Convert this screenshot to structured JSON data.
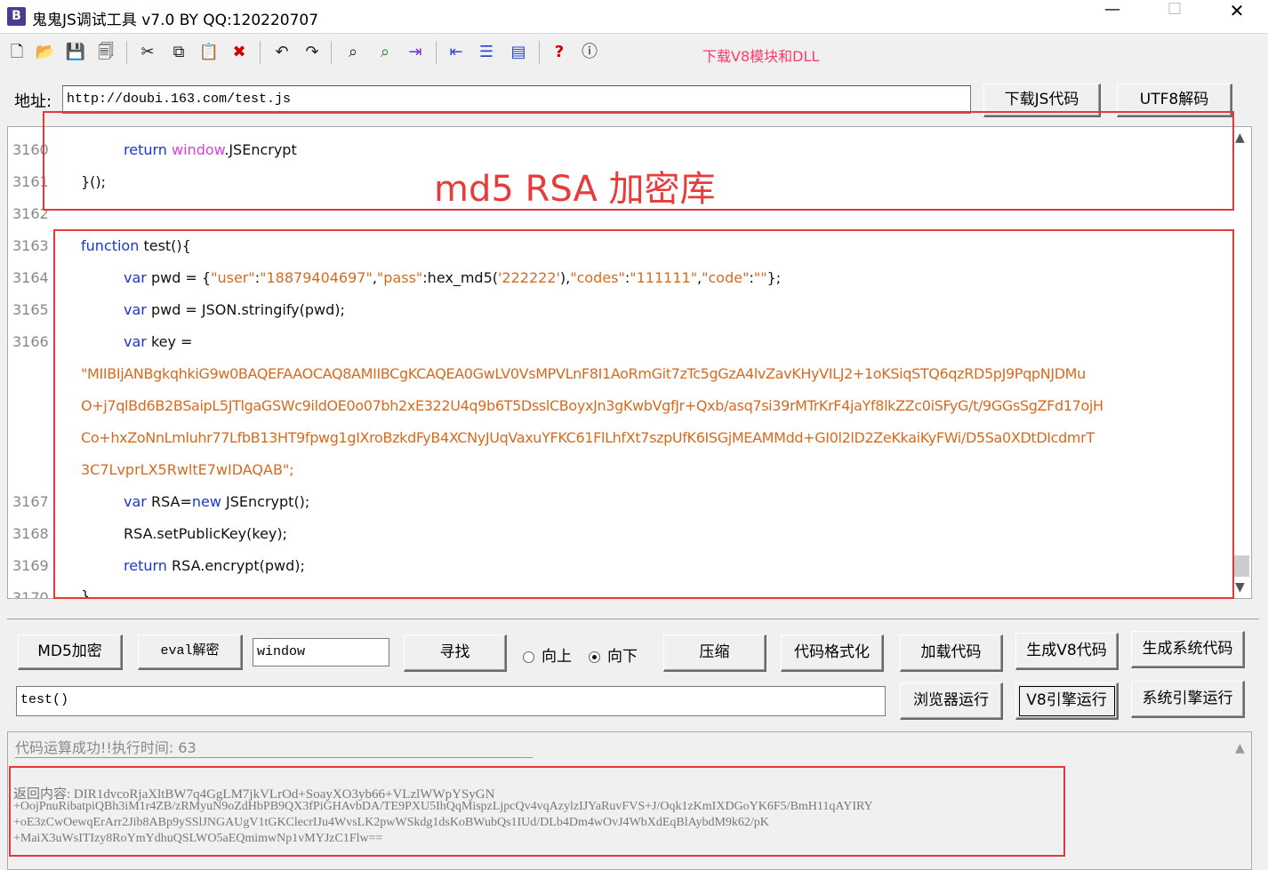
{
  "window": {
    "title": "鬼鬼JS调试工具 v7.0 BY QQ:120220707",
    "app_icon_letter": "B",
    "minimize_glyph": "—",
    "maximize_glyph": "☐",
    "close_glyph": "✕"
  },
  "toolbar": {
    "icons": [
      "new-file-icon",
      "open-folder-icon",
      "save-icon",
      "save-all-icon",
      "cut-icon",
      "copy-icon",
      "paste-icon",
      "delete-icon",
      "undo-icon",
      "redo-icon",
      "find-icon",
      "find-next-icon",
      "indent-icon",
      "outdent-icon",
      "numbered-list-icon",
      "window-icon",
      "help-icon",
      "info-icon"
    ],
    "glyphs": [
      "🗋",
      "📂",
      "💾",
      "🗐",
      "✂",
      "⧉",
      "📋",
      "✖",
      "↶",
      "↷",
      "⌕",
      "⌕",
      "⇥",
      "⇤",
      "☰",
      "▤",
      "?",
      "ⓘ"
    ],
    "download_link": "下载V8模块和DLL"
  },
  "address": {
    "label": "地址:",
    "value": "http://doubi.163.com/test.js",
    "download_button": "下载JS代码",
    "utf8_button": "UTF8解码"
  },
  "editor": {
    "overlay_title": "md5 RSA 加密库",
    "line_numbers": [
      "3160",
      "3161",
      "3162",
      "3163",
      "3164",
      "3165",
      "3166",
      "3167",
      "3168",
      "3169",
      "3170"
    ],
    "line_3160": {
      "kw": "return",
      "obj": "window",
      "rest": ".JSEncrypt"
    },
    "line_3161": "}();",
    "line_3163": {
      "kw": "function",
      "rest": " test(){"
    },
    "line_3164": {
      "kw": "var",
      "pre": " pwd = {",
      "s1": "\"user\"",
      "c1": ":",
      "s2": "\"18879404697\"",
      "c2": ",",
      "s3": "\"pass\"",
      "c3": ":hex_md5(",
      "s4": "'222222'",
      "c4": "),",
      "s5": "\"codes\"",
      "c5": ":",
      "s6": "\"111111\"",
      "c6": ",",
      "s7": "\"code\"",
      "c7": ":",
      "s8": "\"\"",
      "c8": "};"
    },
    "line_3165": {
      "kw": "var",
      "rest": " pwd = JSON.stringify(pwd);"
    },
    "line_3166": {
      "kw": "var",
      "rest": " key ="
    },
    "key_lines": [
      "\"MIIBIjANBgkqhkiG9w0BAQEFAAOCAQ8AMIIBCgKCAQEA0GwLV0VsMPVLnF8I1AoRmGit7zTc5gGzA4lvZavKHyVILJ2+1oKSiqSTQ6qzRD5pJ9PqpNJDMu",
      "O+j7qlBd6B2BSaipL5JTlgaGSWc9ildOE0o07bh2xE322U4q9b6T5DsslCBoyxJn3gKwbVgfJr+Qxb/asq7si39rMTrKrF4jaYf8lkZZc0iSFyG/t/9GGsSgZFd17ojH",
      "Co+hxZoNnLmluhr77LfbB13HT9fpwg1gIXroBzkdFyB4XCNyJUqVaxuYFKC61FlLhfXt7szpUfK6ISGjMEAMMdd+GI0l2lD2ZeKkaiKyFWi/D5Sa0XDtDIcdmrT",
      "3C7LvprLX5RwltE7wIDAQAB\";"
    ],
    "line_3167": {
      "kw": "var",
      "mid": " RSA=",
      "kw2": "new",
      "rest": " JSEncrypt();"
    },
    "line_3168": "RSA.setPublicKey(key);",
    "line_3169": {
      "kw": "return",
      "rest": " RSA.encrypt(pwd);"
    },
    "line_3170": "}"
  },
  "controls": {
    "md5_button": "MD5加密",
    "eval_button": "eval解密",
    "search_value": "window",
    "find_button": "寻找",
    "radio_up": "向上",
    "radio_down": "向下",
    "radio_selected": "down",
    "compress_button": "压缩",
    "format_button": "代码格式化",
    "load_button": "加载代码",
    "gen_v8_button": "生成V8代码",
    "gen_sys_button": "生成系统代码",
    "expression_value": "test()",
    "browser_run_button": "浏览器运行",
    "v8_run_button": "V8引擎运行",
    "sys_run_button": "系统引擎运行"
  },
  "output": {
    "status": "代码运算成功!!执行时间: 63",
    "return_label": "返回内容: ",
    "return_lines": [
      "DIR1dvcoRjaXltBW7q4GgLM7jkVLrOd+SoayXO3yb66+VLzlWWpYSyGN",
      "+OojPnuRibatpiQBh3iM1r4ZB/zRMyuN9oZdHbPB9QX3fPiGHAvbDA/TE9PXU5IhQqMispzLjpcQv4vqAzylzIJYaRuvFVS+J/Oqk1zKmIXDGoYK6F5/BmH11qAYIRY",
      "+oE3zCwOewqErArr2Jib8ABp9ySSlJNGAUgV1tGKClecrIJu4WvsLK2pwWSkdg1dsKoBWubQs1IUd/DLb4Dm4wOvJ4WbXdEqBlAybdM9k62/pK",
      "+MaiX3uWsITIzy8RoYmYdhuQSLWO5aEQmimwNp1vMYJzC1Flw=="
    ]
  },
  "colors": {
    "keyword": "#1b35d4",
    "window_object": "#e23ce2",
    "string": "#d86a1d",
    "annotation_red": "#e23a3a",
    "download_link": "#ff3a6b"
  }
}
